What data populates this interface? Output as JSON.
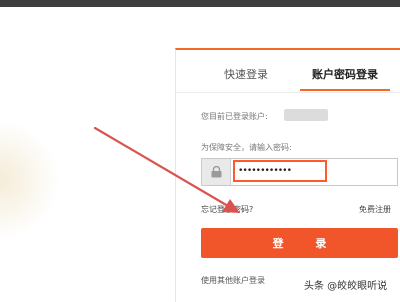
{
  "tabs": {
    "quick_login": "快速登录",
    "account_login": "账户密码登录"
  },
  "account": {
    "current_label": "您目前已登录账户:"
  },
  "password": {
    "hint": "为保障安全，请输入密码:",
    "value": "••••••••••••"
  },
  "links": {
    "forgot": "忘记登录密码?",
    "register": "免费注册"
  },
  "buttons": {
    "login": "登 录"
  },
  "footer": {
    "other_account": "使用其他账户登录"
  },
  "watermark": {
    "text": "头条 @皎皎眼听说"
  },
  "colors": {
    "accent": "#f0562a",
    "input_border": "#ff5a2a",
    "annotation_arrow": "#d9534f"
  },
  "icons": {
    "lock": "lock-icon"
  }
}
